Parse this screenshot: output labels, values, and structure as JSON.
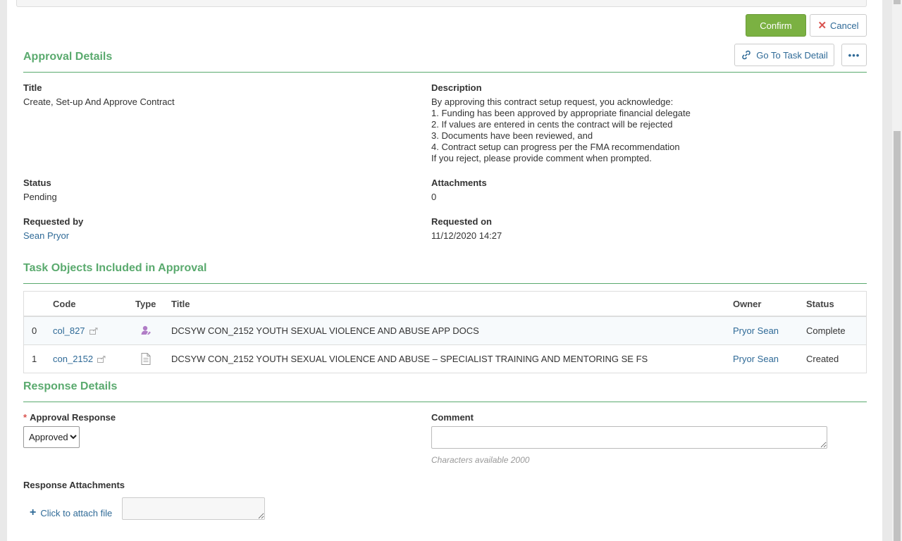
{
  "actions": {
    "confirm_label": "Confirm",
    "cancel_label": "Cancel",
    "go_to_task_label": "Go To Task Detail",
    "more_label": "•••"
  },
  "approval_details": {
    "section_title": "Approval Details",
    "title_label": "Title",
    "title_value": "Create, Set-up And Approve Contract",
    "description_label": "Description",
    "description_lines": [
      "By approving this contract setup request, you acknowledge:",
      "1. Funding has been approved by appropriate financial delegate",
      "2. If values are entered in cents the contract will be rejected",
      "3. Documents have been reviewed, and",
      "4. Contract setup can progress per the FMA recommendation",
      "If you reject, please provide comment when prompted."
    ],
    "status_label": "Status",
    "status_value": "Pending",
    "attachments_label": "Attachments",
    "attachments_value": "0",
    "requested_by_label": "Requested by",
    "requested_by_value": "Sean Pryor",
    "requested_on_label": "Requested on",
    "requested_on_value": "11/12/2020 14:27"
  },
  "task_objects": {
    "section_title": "Task Objects Included in Approval",
    "columns": [
      "Code",
      "Type",
      "Title",
      "Owner",
      "Status"
    ],
    "rows": [
      {
        "index": "0",
        "code": "col_827",
        "type_icon": "collection-person-icon",
        "title": "DCSYW CON_2152 YOUTH SEXUAL VIOLENCE AND ABUSE APP DOCS",
        "owner": "Pryor Sean",
        "status": "Complete"
      },
      {
        "index": "1",
        "code": "con_2152",
        "type_icon": "document-icon",
        "title": "DCSYW CON_2152 YOUTH SEXUAL VIOLENCE AND ABUSE – SPECIALIST TRAINING AND MENTORING SE FS",
        "owner": "Pryor Sean",
        "status": "Created"
      }
    ]
  },
  "response_details": {
    "section_title": "Response Details",
    "required_marker": "*",
    "approval_response_label": "Approval Response",
    "approval_response_value": "Approved",
    "comment_label": "Comment",
    "comment_hint": "Characters available 2000",
    "attachments_label": "Response Attachments",
    "attach_link_label": "Click to attach file"
  },
  "colors": {
    "accent_green": "#5aaa6e",
    "confirm_green": "#7bb142",
    "link_blue": "#2f6a97",
    "cancel_red": "#d9534f"
  }
}
